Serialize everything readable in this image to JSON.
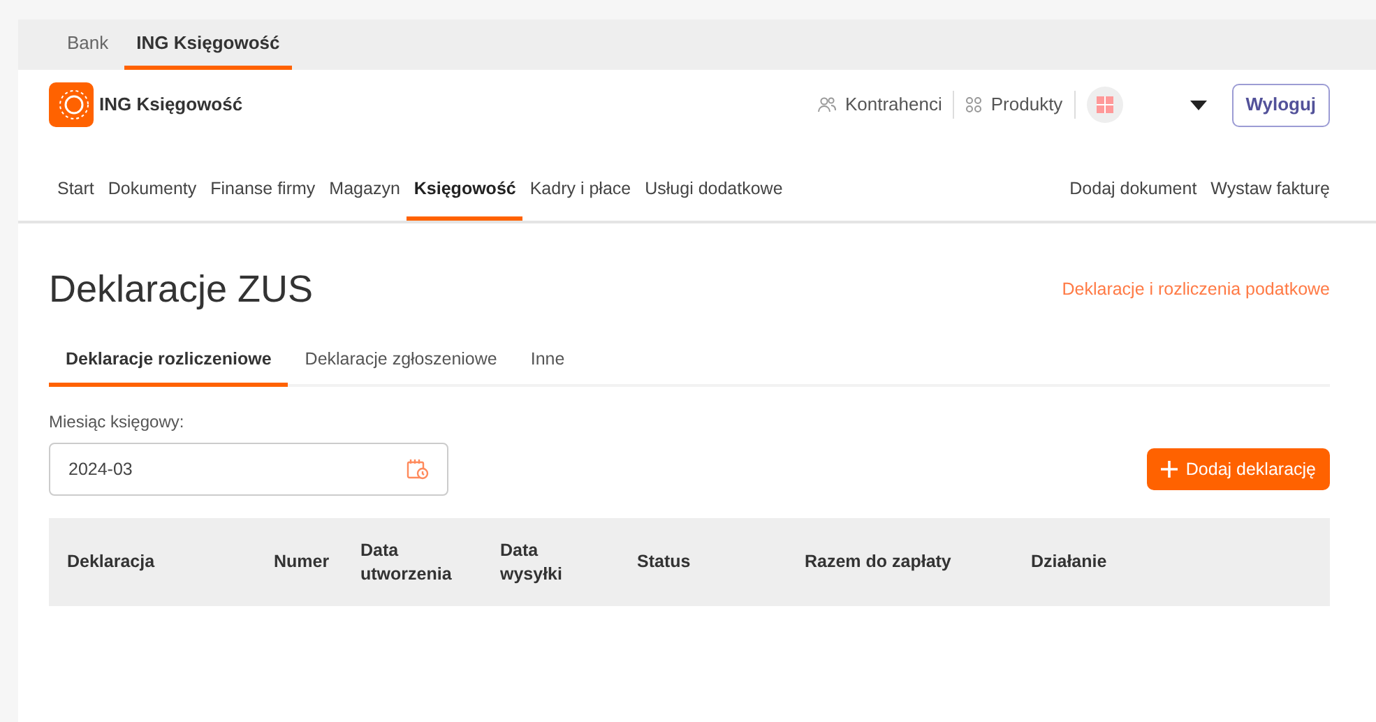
{
  "top_tabs": [
    {
      "label": "Bank",
      "selected": false
    },
    {
      "label": "ING Księgowość",
      "selected": true
    }
  ],
  "header": {
    "app_name": "ING Księgowość",
    "links": [
      {
        "label": "Kontrahenci",
        "kind": "people"
      },
      {
        "label": "Produkty",
        "kind": "grid"
      }
    ],
    "logout": "Wyloguj"
  },
  "nav": {
    "items": [
      {
        "label": "Start",
        "selected": false
      },
      {
        "label": "Dokumenty",
        "selected": false
      },
      {
        "label": "Finanse firmy",
        "selected": false
      },
      {
        "label": "Magazyn",
        "selected": false
      },
      {
        "label": "Księgowość",
        "selected": true
      },
      {
        "label": "Kadry i płace",
        "selected": false
      },
      {
        "label": "Usługi dodatkowe",
        "selected": false
      }
    ],
    "actions": [
      "Dodaj dokument",
      "Wystaw fakturę"
    ]
  },
  "page": {
    "title": "Deklaracje ZUS",
    "side_link": "Deklaracje i rozliczenia podatkowe",
    "tabs": [
      {
        "label": "Deklaracje rozliczeniowe",
        "selected": true
      },
      {
        "label": "Deklaracje zgłoszeniowe",
        "selected": false
      },
      {
        "label": "Inne",
        "selected": false
      }
    ],
    "month_label": "Miesiąc księgowy:",
    "month_value": "2024-03",
    "add_button": "Dodaj deklarację",
    "table": {
      "columns": [
        "Deklaracja",
        "Numer",
        "Data utworzenia",
        "Data wysyłki",
        "Status",
        "Razem do zapłaty",
        "Działanie"
      ]
    }
  }
}
